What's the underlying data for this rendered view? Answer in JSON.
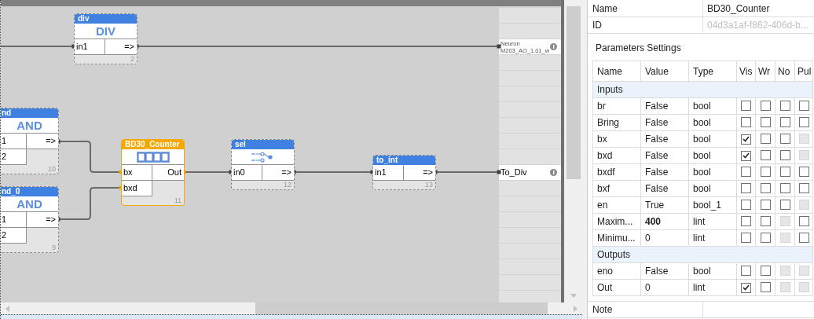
{
  "diagram": {
    "blocks": [
      {
        "title": "div",
        "selected": false,
        "body": {
          "kind": "label",
          "text": "DIV"
        },
        "inputs": [
          "in1"
        ],
        "outputs": [
          "=>"
        ],
        "number": "2"
      },
      {
        "title": "nd",
        "selected": false,
        "body": {
          "kind": "label",
          "text": "AND"
        },
        "inputs": [
          "1",
          "2"
        ],
        "outputs": [
          "=>"
        ],
        "number": "10"
      },
      {
        "title": "nd_0",
        "selected": false,
        "body": {
          "kind": "label",
          "text": "AND"
        },
        "inputs": [
          "1",
          "2"
        ],
        "outputs": [
          "=>"
        ],
        "number": "9"
      },
      {
        "title": "BD30_Counter",
        "selected": true,
        "body": {
          "kind": "counter"
        },
        "inputs": [
          "bx",
          "bxd"
        ],
        "outputs": [
          "Out"
        ],
        "number": "11"
      },
      {
        "title": "sel",
        "selected": false,
        "body": {
          "kind": "selector"
        },
        "inputs": [
          "in0"
        ],
        "outputs": [
          "=>"
        ],
        "number": "12"
      },
      {
        "title": "to_int",
        "selected": false,
        "body": {
          "kind": "none"
        },
        "inputs": [
          "in1"
        ],
        "outputs": [
          "=>"
        ],
        "number": "13"
      }
    ],
    "terminals": [
      {
        "lines": [
          "Neuron",
          "M203_AO_1.01_w"
        ]
      },
      {
        "lines": [
          "To_Div"
        ]
      }
    ]
  },
  "properties": {
    "name_label": "Name",
    "name_value": "BD30_Counter",
    "id_label": "ID",
    "id_value": "04d3a1af-f862-406d-b...",
    "section_title": "Parameters Settings",
    "columns": [
      "Name",
      "Value",
      "Type",
      "Vis",
      "Wr",
      "No",
      "Pul"
    ],
    "groups": [
      {
        "title": "Inputs",
        "rows": [
          {
            "name": "br",
            "value": "False",
            "modified": false,
            "type": "bool",
            "flags": [
              {
                "checked": false,
                "disabled": false
              },
              {
                "checked": false,
                "disabled": false
              },
              {
                "checked": false,
                "disabled": false
              },
              {
                "checked": false,
                "disabled": false
              }
            ]
          },
          {
            "name": "Bring",
            "value": "False",
            "modified": false,
            "type": "bool",
            "flags": [
              {
                "checked": false,
                "disabled": false
              },
              {
                "checked": false,
                "disabled": false
              },
              {
                "checked": false,
                "disabled": false
              },
              {
                "checked": false,
                "disabled": false
              }
            ]
          },
          {
            "name": "bx",
            "value": "False",
            "modified": false,
            "type": "bool",
            "flags": [
              {
                "checked": true,
                "disabled": false
              },
              {
                "checked": false,
                "disabled": false
              },
              {
                "checked": false,
                "disabled": false
              },
              {
                "checked": false,
                "disabled": true
              }
            ]
          },
          {
            "name": "bxd",
            "value": "False",
            "modified": false,
            "type": "bool",
            "flags": [
              {
                "checked": true,
                "disabled": false
              },
              {
                "checked": false,
                "disabled": false
              },
              {
                "checked": false,
                "disabled": false
              },
              {
                "checked": false,
                "disabled": true
              }
            ]
          },
          {
            "name": "bxdf",
            "value": "False",
            "modified": false,
            "type": "bool",
            "flags": [
              {
                "checked": false,
                "disabled": false
              },
              {
                "checked": false,
                "disabled": false
              },
              {
                "checked": false,
                "disabled": false
              },
              {
                "checked": false,
                "disabled": false
              }
            ]
          },
          {
            "name": "bxf",
            "value": "False",
            "modified": false,
            "type": "bool",
            "flags": [
              {
                "checked": false,
                "disabled": false
              },
              {
                "checked": false,
                "disabled": false
              },
              {
                "checked": false,
                "disabled": false
              },
              {
                "checked": false,
                "disabled": false
              }
            ]
          },
          {
            "name": "en",
            "value": "True",
            "modified": false,
            "type": "bool_1",
            "flags": [
              {
                "checked": false,
                "disabled": false
              },
              {
                "checked": false,
                "disabled": false
              },
              {
                "checked": false,
                "disabled": false
              },
              {
                "checked": false,
                "disabled": true
              }
            ]
          },
          {
            "name": "Maxim...",
            "value": "400",
            "modified": true,
            "type": "lint",
            "flags": [
              {
                "checked": false,
                "disabled": false
              },
              {
                "checked": false,
                "disabled": false
              },
              {
                "checked": false,
                "disabled": true
              },
              {
                "checked": false,
                "disabled": false
              }
            ]
          },
          {
            "name": "Minimu...",
            "value": "0",
            "modified": false,
            "type": "lint",
            "flags": [
              {
                "checked": false,
                "disabled": false
              },
              {
                "checked": false,
                "disabled": false
              },
              {
                "checked": false,
                "disabled": true
              },
              {
                "checked": false,
                "disabled": false
              }
            ]
          }
        ]
      },
      {
        "title": "Outputs",
        "rows": [
          {
            "name": "eno",
            "value": "False",
            "modified": false,
            "type": "bool",
            "flags": [
              {
                "checked": false,
                "disabled": false
              },
              {
                "checked": false,
                "disabled": false
              },
              {
                "checked": false,
                "disabled": true
              },
              {
                "checked": false,
                "disabled": true
              }
            ]
          },
          {
            "name": "Out",
            "value": "0",
            "modified": false,
            "type": "lint",
            "flags": [
              {
                "checked": true,
                "disabled": false
              },
              {
                "checked": false,
                "disabled": false
              },
              {
                "checked": false,
                "disabled": true
              },
              {
                "checked": false,
                "disabled": true
              }
            ]
          }
        ]
      }
    ],
    "note_label": "Note"
  }
}
